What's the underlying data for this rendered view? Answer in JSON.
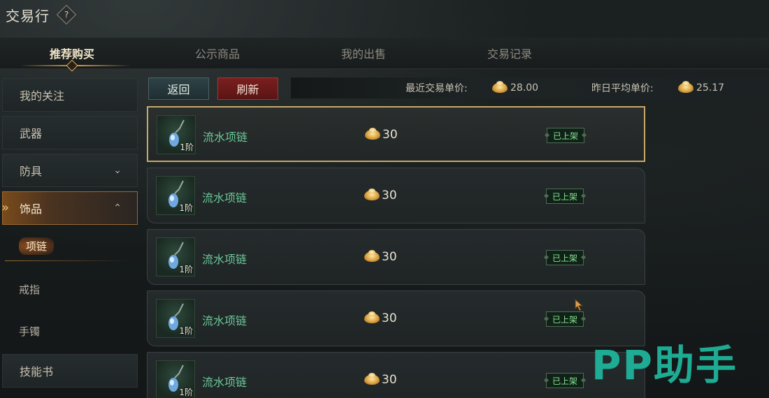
{
  "window": {
    "title": "交易行",
    "help_symbol": "?"
  },
  "tabs": [
    {
      "label": "推荐购买",
      "active": true
    },
    {
      "label": "公示商品",
      "active": false
    },
    {
      "label": "我的出售",
      "active": false
    },
    {
      "label": "交易记录",
      "active": false
    }
  ],
  "sidebar": {
    "items": [
      {
        "label": "我的关注"
      },
      {
        "label": "武器"
      },
      {
        "label": "防具",
        "chevron": "chevron-down-icon"
      },
      {
        "label": "饰品",
        "chevron": "chevron-up-icon",
        "active": true
      },
      {
        "label": "技能书"
      }
    ],
    "subitems": [
      {
        "label": "项链",
        "active": true
      },
      {
        "label": "戒指"
      },
      {
        "label": "手镯"
      }
    ]
  },
  "toolbar": {
    "back_label": "返回",
    "refresh_label": "刷新",
    "recent_price_label": "最近交易单价:",
    "recent_price_value": "28.00",
    "avg_price_label": "昨日平均单价:",
    "avg_price_value": "25.17"
  },
  "listings": [
    {
      "name": "流水项链",
      "tier": "1阶",
      "price": "30",
      "status": "已上架",
      "selected": true
    },
    {
      "name": "流水项链",
      "tier": "1阶",
      "price": "30",
      "status": "已上架"
    },
    {
      "name": "流水项链",
      "tier": "1阶",
      "price": "30",
      "status": "已上架"
    },
    {
      "name": "流水项链",
      "tier": "1阶",
      "price": "30",
      "status": "已上架"
    },
    {
      "name": "流水项链",
      "tier": "1阶",
      "price": "30",
      "status": "已上架"
    }
  ],
  "watermark": "PP助手",
  "colors": {
    "item_name": "#6cc99a",
    "status_green": "#86e28e",
    "accent_gold": "#c7a96a",
    "refresh_red": "#7a1f1f",
    "watermark_teal": "#1fb39a"
  }
}
